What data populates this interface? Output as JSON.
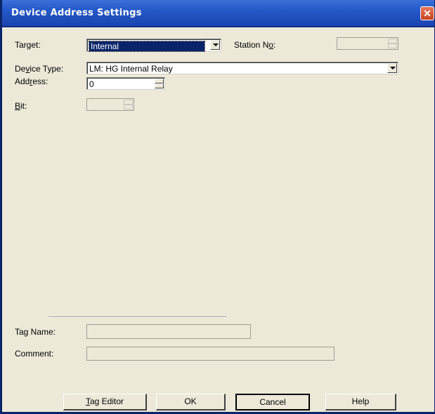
{
  "window": {
    "title": "Device Address Settings"
  },
  "form": {
    "target": {
      "label_pre": "Tar",
      "label_key": "g",
      "label_post": "et:",
      "value": "Internal"
    },
    "station_no": {
      "label_pre": "Station N",
      "label_key": "o",
      "label_post": ":",
      "value": ""
    },
    "device_type": {
      "label_pre": "De",
      "label_key": "v",
      "label_post": "ice Type:",
      "value": "LM: HG Internal Relay"
    },
    "address": {
      "label_pre": "Add",
      "label_key": "r",
      "label_post": "ess:",
      "value": "0"
    },
    "bit": {
      "label_pre": "",
      "label_key": "B",
      "label_post": "it:",
      "value": ""
    },
    "tag_name": {
      "label": "Tag Name:",
      "value": ""
    },
    "comment": {
      "label": "Comment:",
      "value": ""
    }
  },
  "buttons": {
    "tag_editor": {
      "label_key": "T",
      "label_post": "ag Editor"
    },
    "ok": "OK",
    "cancel": "Cancel",
    "help": "Help"
  },
  "icons": {
    "close": "close-icon",
    "dropdown": "chevron-down-icon",
    "spinner": "spinner-icon"
  }
}
